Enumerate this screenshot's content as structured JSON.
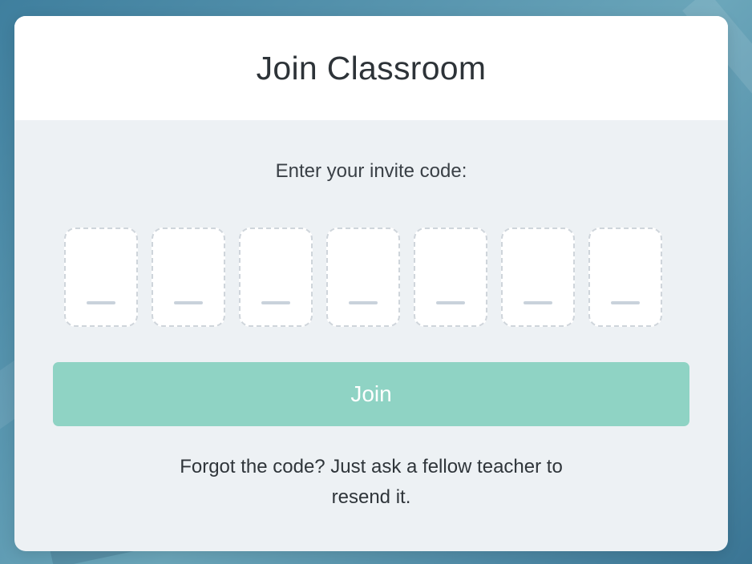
{
  "dialog": {
    "title": "Join Classroom",
    "prompt": "Enter your invite code:",
    "code_input": {
      "length": 7,
      "values": [
        "",
        "",
        "",
        "",
        "",
        "",
        ""
      ]
    },
    "join_label": "Join",
    "help_text": "Forgot the code? Just ask a fellow teacher to resend it."
  },
  "colors": {
    "accent": "#8fd3c4",
    "card_body": "#edf1f4",
    "header": "#ffffff",
    "background": "#5a97b0"
  }
}
